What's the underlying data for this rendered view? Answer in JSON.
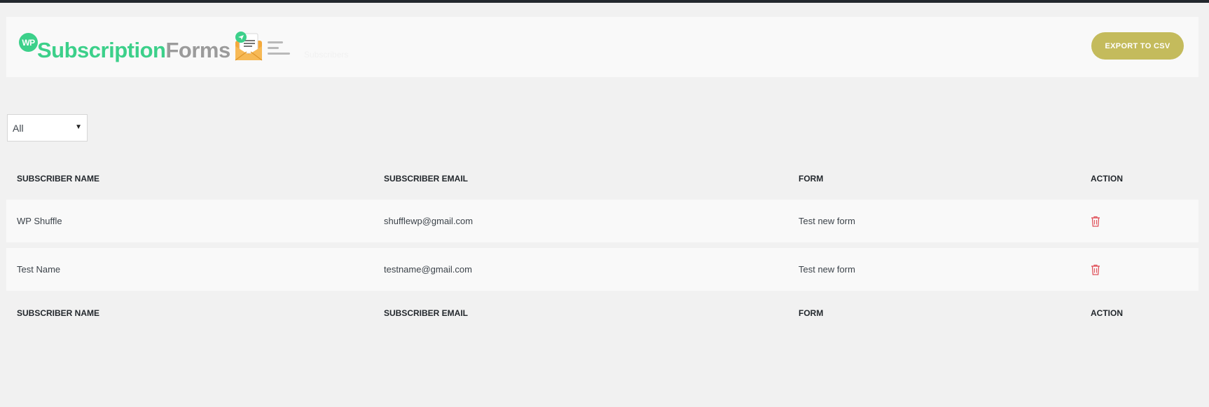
{
  "header": {
    "logo": {
      "badge": "WP",
      "word1": "Subscription",
      "word2": "Forms"
    },
    "ghost_text": "Subscribers",
    "export_label": "EXPORT TO CSV"
  },
  "filter": {
    "selected": "All"
  },
  "table": {
    "columns": [
      "SUBSCRIBER NAME",
      "SUBSCRIBER EMAIL",
      "FORM",
      "ACTION"
    ],
    "rows": [
      {
        "name": "WP Shuffle",
        "email": "shufflewp@gmail.com",
        "form": "Test new form",
        "action": "delete-icon"
      },
      {
        "name": "Test Name",
        "email": "testname@gmail.com",
        "form": "Test new form",
        "action": "delete-icon"
      }
    ]
  },
  "colors": {
    "brand_green": "#3cd08a",
    "brand_gray": "#9b9b9b",
    "export_button": "#c4bb5c",
    "delete_red": "#e0525b"
  }
}
